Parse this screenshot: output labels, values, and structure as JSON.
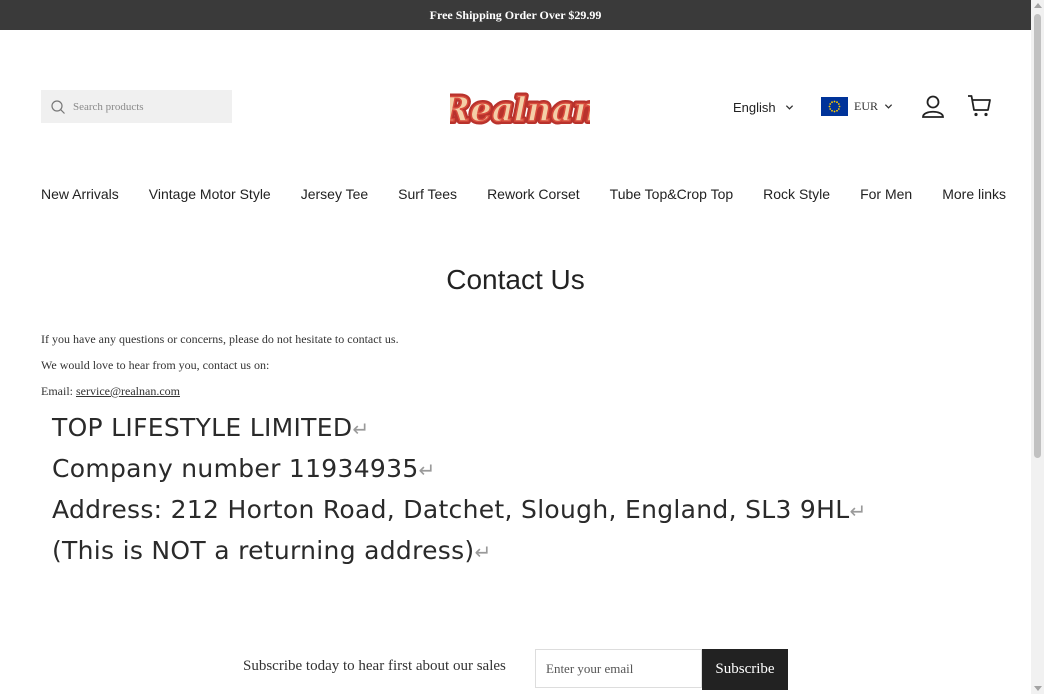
{
  "announcement": "Free Shipping Order Over $29.99",
  "header": {
    "search_placeholder": "Search products",
    "logo_text": "Realnan",
    "language": "English",
    "currency": "EUR"
  },
  "nav": {
    "items": [
      {
        "label": "New Arrivals"
      },
      {
        "label": "Vintage Motor Style"
      },
      {
        "label": "Jersey Tee"
      },
      {
        "label": "Surf Tees"
      },
      {
        "label": "Rework Corset"
      },
      {
        "label": "Tube Top&Crop Top"
      },
      {
        "label": "Rock Style"
      },
      {
        "label": "For Men"
      },
      {
        "label": "More links"
      }
    ]
  },
  "page": {
    "title": "Contact Us",
    "p1": "If you have any questions or concerns, please do not hesitate to contact us.",
    "p2": "We would love to hear from you, contact us on:",
    "email_label": "Email: ",
    "email_link": "service@realnan.com",
    "company_lines": [
      "TOP LIFESTYLE LIMITED",
      "Company number 11934935",
      "Address: 212 Horton Road, Datchet, Slough, England, SL3 9HL",
      "(This is NOT a returning address)"
    ],
    "return_glyph": "↵"
  },
  "footer": {
    "subscribe_text": "Subscribe today to hear first about our sales",
    "email_placeholder": "Enter your email",
    "subscribe_button": "Subscribe"
  }
}
